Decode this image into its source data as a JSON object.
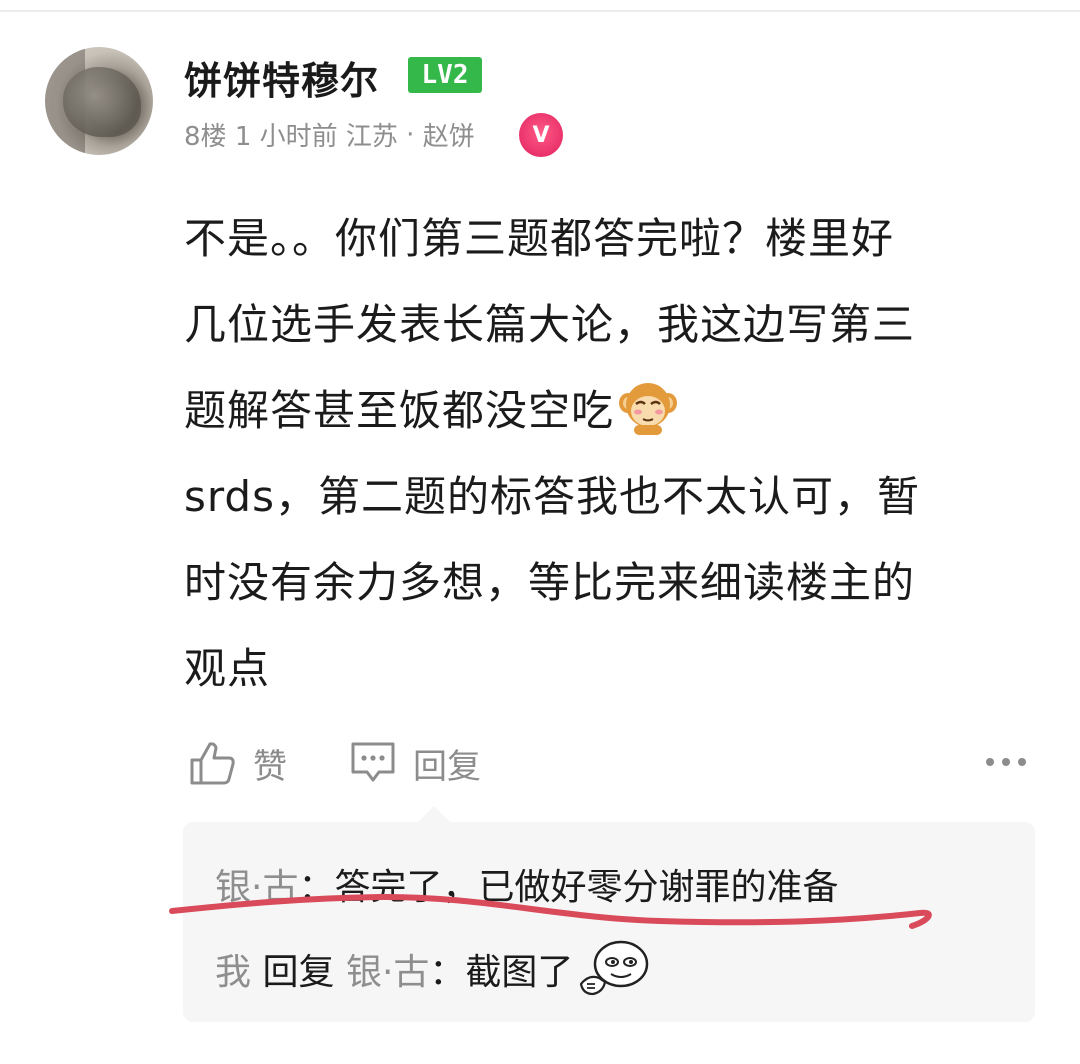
{
  "comment": {
    "username": "饼饼特穆尔",
    "level": "LV2",
    "meta": {
      "floor": "8楼",
      "time": "1 小时前",
      "location": "江苏",
      "separator": "·",
      "tag": "赵饼"
    },
    "body_lines": [
      "不是。。你们第三题都答完啦？楼里好",
      "几位选手发表长篇大论，我这边写第三",
      "题解答甚至饭都没空吃",
      "srds，第二题的标答我也不太认可，暂",
      "时没有余力多想，等比完来细读楼主的",
      "观点"
    ],
    "actions": {
      "like_label": "赞",
      "reply_label": "回复"
    }
  },
  "replies": [
    {
      "author": "银·古",
      "colon": "：",
      "text": "答完了，已做好零分谢罪的准备"
    },
    {
      "author": "我",
      "reply_word": "回复",
      "target": "银·古",
      "colon": "：",
      "text": "截图了"
    }
  ],
  "annotation": {
    "underline_color": "#d94a5a"
  },
  "colors": {
    "level_badge": "#34b84a",
    "vip_icon": "#e0205e",
    "muted_text": "#8e8e8e"
  }
}
